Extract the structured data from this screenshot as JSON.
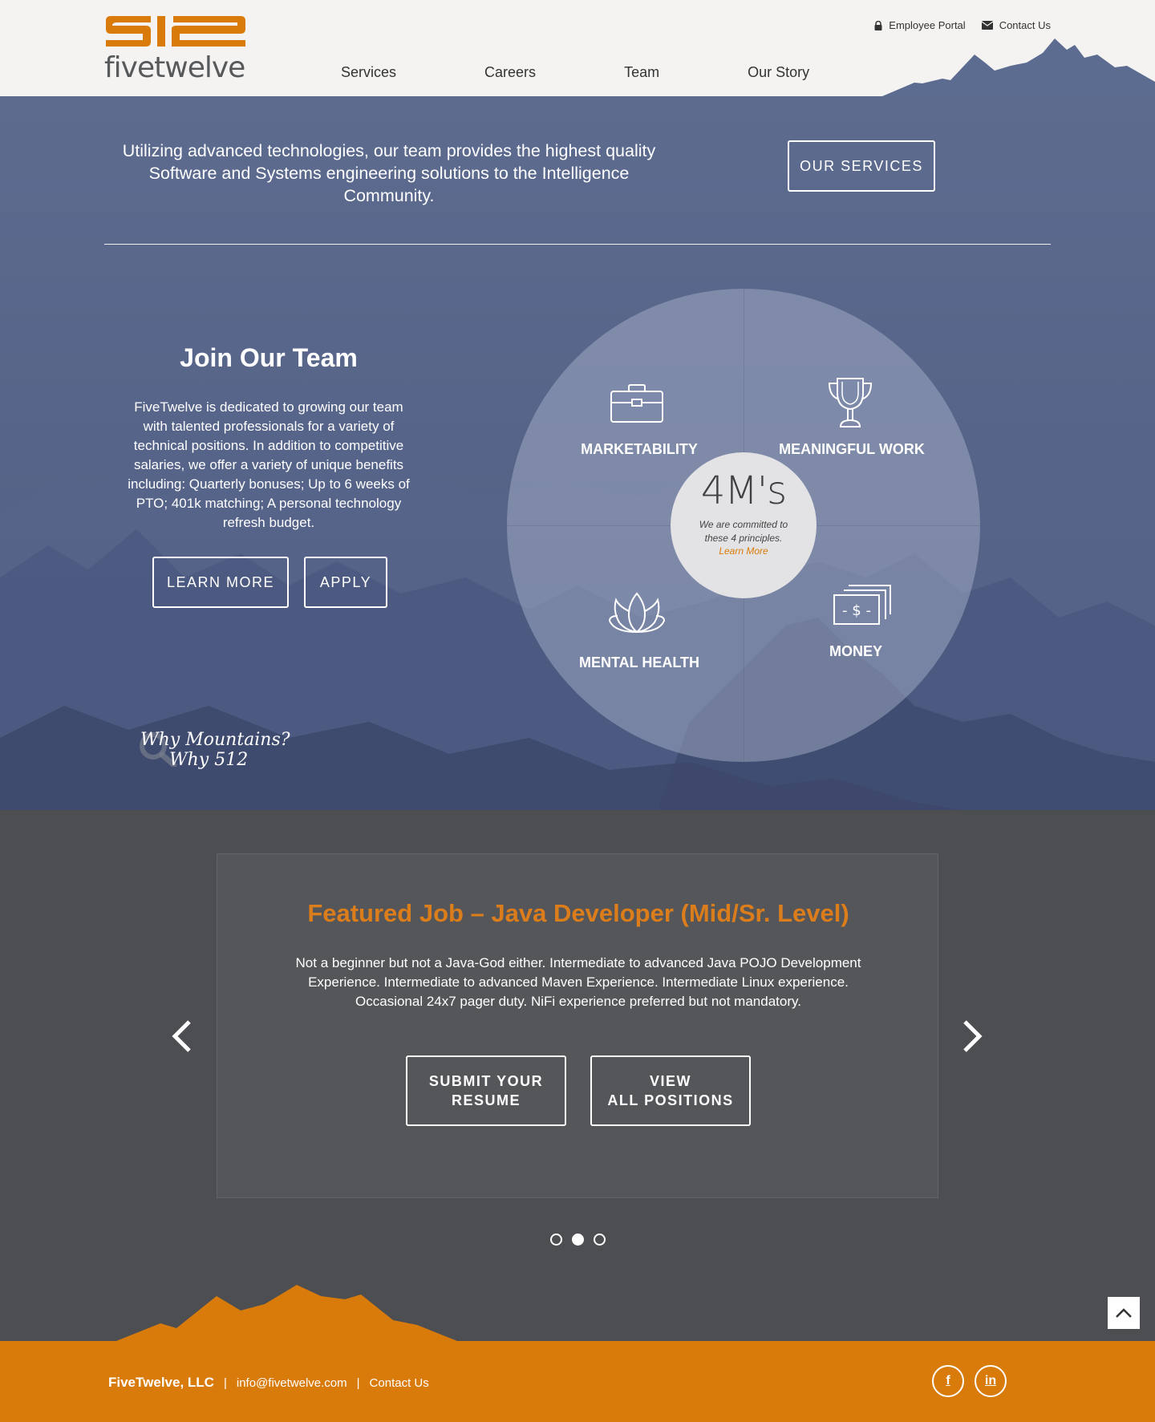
{
  "header": {
    "logo_text": "fivetwelve",
    "logo_mark": "512",
    "top_links": [
      {
        "label": "Employee Portal",
        "icon": "lock-icon"
      },
      {
        "label": "Contact Us",
        "icon": "envelope-icon"
      }
    ],
    "nav": [
      "Services",
      "Careers",
      "Team",
      "Our Story"
    ]
  },
  "hero": {
    "tagline": "Utilizing advanced technologies, our team provides the highest quality Software and Systems engineering solutions to the Intelligence Community.",
    "services_button": "OUR SERVICES"
  },
  "join": {
    "title": "Join Our Team",
    "text": "FiveTwelve is dedicated to growing our team with talented professionals for a variety of technical positions. In addition to competitive salaries, we offer a variety of unique benefits including: Quarterly bonuses; Up to 6 weeks of PTO; 401k matching; A personal technology refresh budget.",
    "learn_more": "LEARN MORE",
    "apply": "APPLY"
  },
  "principles": {
    "center_title": "4M's",
    "center_text": "We are committed to these 4 principles.",
    "center_link": "Learn More",
    "items": [
      {
        "label": "MARKETABILITY",
        "icon": "briefcase-icon"
      },
      {
        "label": "MEANINGFUL WORK",
        "icon": "trophy-icon"
      },
      {
        "label": "MENTAL HEALTH",
        "icon": "lotus-icon"
      },
      {
        "label": "MONEY",
        "icon": "money-icon"
      }
    ]
  },
  "why": {
    "line1": "Why Mountains?",
    "line2": "Why 512"
  },
  "featured_job": {
    "title": "Featured Job – Java Developer (Mid/Sr. Level)",
    "description": "Not a beginner but not a Java-God either.  Intermediate to advanced Java POJO Development Experience.  Intermediate to advanced  Maven Experience.  Intermediate Linux experience.  Occasional 24x7 pager duty.  NiFi experience preferred but not mandatory.",
    "submit_line1": "SUBMIT YOUR",
    "submit_line2": "RESUME",
    "view_line1": "VIEW",
    "view_line2": "ALL POSITIONS",
    "slide_count": 3,
    "active_slide": 2
  },
  "footer": {
    "company": "FiveTwelve, LLC",
    "email": "info@fivetwelve.com",
    "contact": "Contact Us",
    "social": [
      {
        "name": "facebook-icon",
        "glyph": "f"
      },
      {
        "name": "linkedin-icon",
        "glyph": "in"
      }
    ]
  },
  "colors": {
    "brand_orange": "#d97b0a",
    "hero_blue": "#5c6b90",
    "dark_gray": "#4d4e52"
  }
}
